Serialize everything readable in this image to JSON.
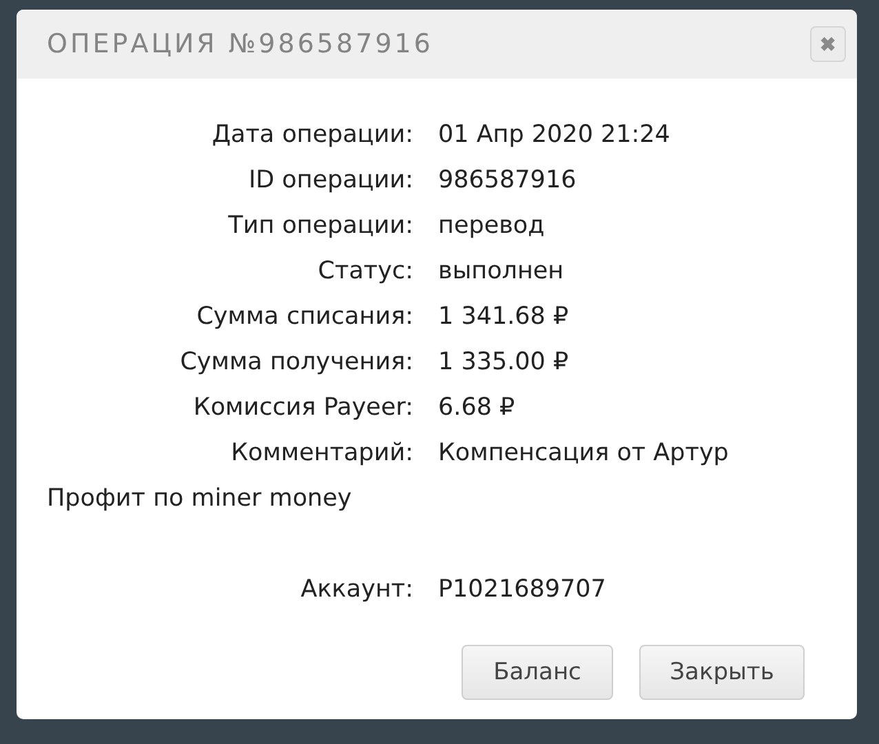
{
  "dialog": {
    "title": "ОПЕРАЦИЯ №986587916",
    "close": "✖"
  },
  "details": [
    {
      "kind": "field",
      "label": "Дата операции:",
      "value": "01 Апр 2020 21:24"
    },
    {
      "kind": "field",
      "label": "ID операции:",
      "value": "986587916"
    },
    {
      "kind": "field",
      "label": "Тип операции:",
      "value": "перевод"
    },
    {
      "kind": "field",
      "label": "Статус:",
      "value": "выполнен"
    },
    {
      "kind": "field",
      "label": "Сумма списания:",
      "value": "1 341.68 ₽"
    },
    {
      "kind": "field",
      "label": "Сумма получения:",
      "value": "1 335.00 ₽"
    },
    {
      "kind": "field",
      "label": "Комиссия Payeer:",
      "value": "6.68 ₽"
    },
    {
      "kind": "comment",
      "label": "Комментарий:",
      "value": "Компенсация от Артур",
      "continuation": "Профит по miner money"
    },
    {
      "kind": "field",
      "label": "Аккаунт:",
      "value": "P1021689707"
    }
  ],
  "buttons": [
    "Баланс",
    "Закрыть"
  ]
}
